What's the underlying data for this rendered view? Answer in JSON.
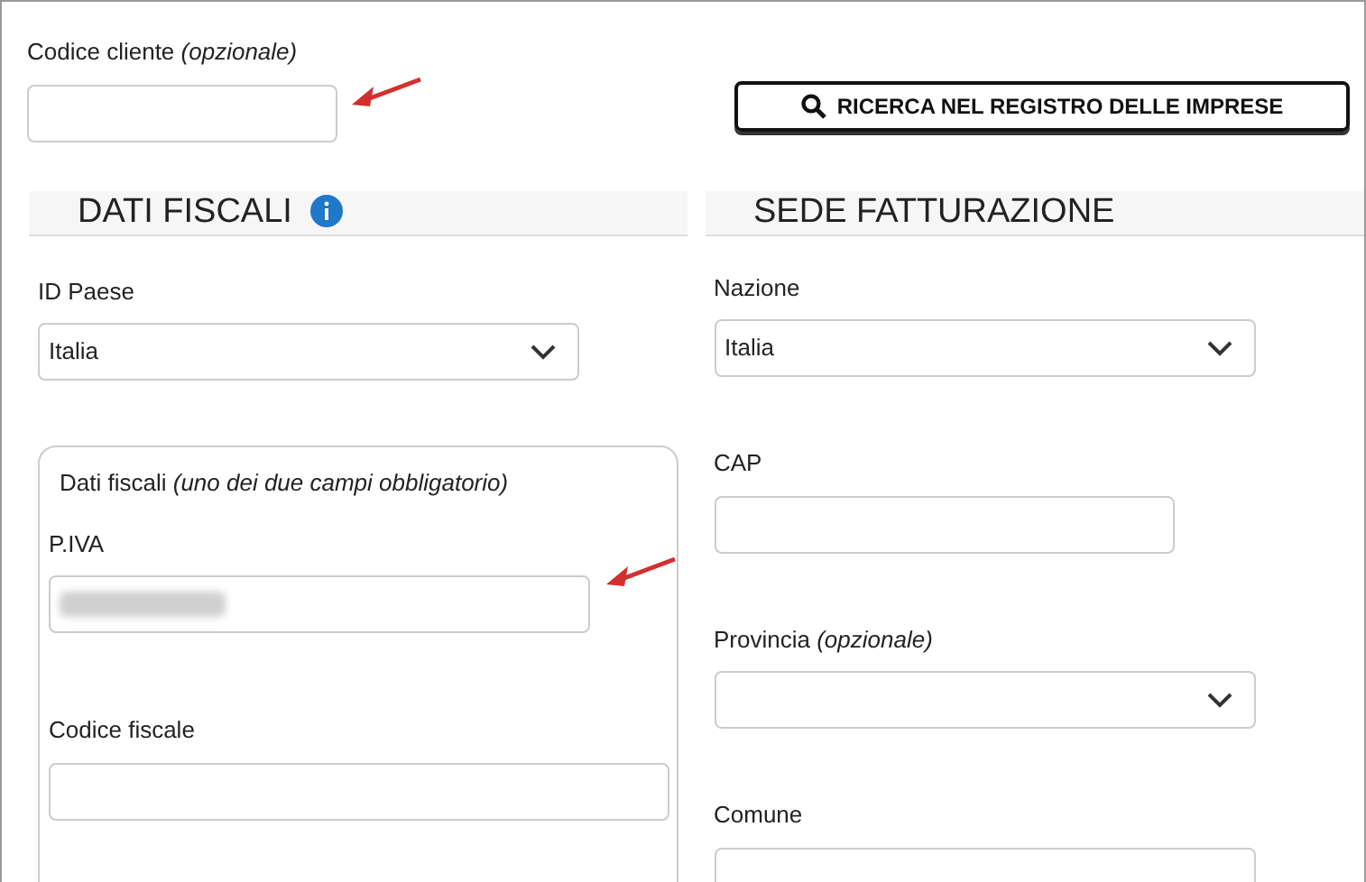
{
  "customer_code": {
    "label": "Codice cliente *(opzionale)*"
  },
  "search_button": {
    "label": "RICERCA NEL REGISTRO DELLE IMPRESE"
  },
  "left": {
    "heading": "DATI FISCALI",
    "info": true,
    "country_id": {
      "label": "ID Paese",
      "value": "Italia"
    },
    "fiscal_group": {
      "legend": "Dati fiscali *(uno dei due campi obbligatorio)*",
      "fields": [
        {
          "label": "P.IVA",
          "redacted": true
        },
        {
          "label": "Codice fiscale",
          "redacted": false
        }
      ]
    }
  },
  "right": {
    "heading": "SEDE FATTURAZIONE",
    "fields": [
      {
        "kind": "select",
        "label": "Nazione",
        "value": "Italia"
      },
      {
        "kind": "text",
        "label": "CAP"
      },
      {
        "kind": "select",
        "label": "Provincia *(opzionale)*"
      },
      {
        "kind": "text",
        "label": "Comune"
      }
    ]
  }
}
